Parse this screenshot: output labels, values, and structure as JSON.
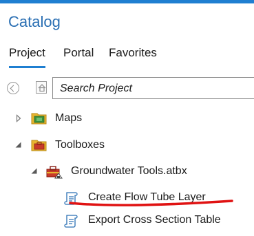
{
  "pane": {
    "title": "Catalog"
  },
  "tabs": [
    {
      "label": "Project",
      "active": true
    },
    {
      "label": "Portal",
      "active": false
    },
    {
      "label": "Favorites",
      "active": false
    }
  ],
  "search": {
    "placeholder": "Search Project",
    "value": ""
  },
  "tree": {
    "maps": {
      "label": "Maps",
      "expanded": false,
      "icon": "folder-maps-icon"
    },
    "toolboxes": {
      "label": "Toolboxes",
      "expanded": true,
      "icon": "folder-toolbox-icon"
    },
    "toolbox": {
      "label": "Groundwater Tools.atbx",
      "expanded": true,
      "icon": "toolbox-icon"
    },
    "tools": [
      {
        "label": "Create Flow Tube Layer",
        "icon": "script-tool-icon",
        "highlighted": true
      },
      {
        "label": "Export Cross Section Table",
        "icon": "script-tool-icon",
        "highlighted": false
      }
    ]
  },
  "colors": {
    "accent": "#1f7fd1",
    "title": "#2a6fb3",
    "annotation": "#e01212"
  }
}
